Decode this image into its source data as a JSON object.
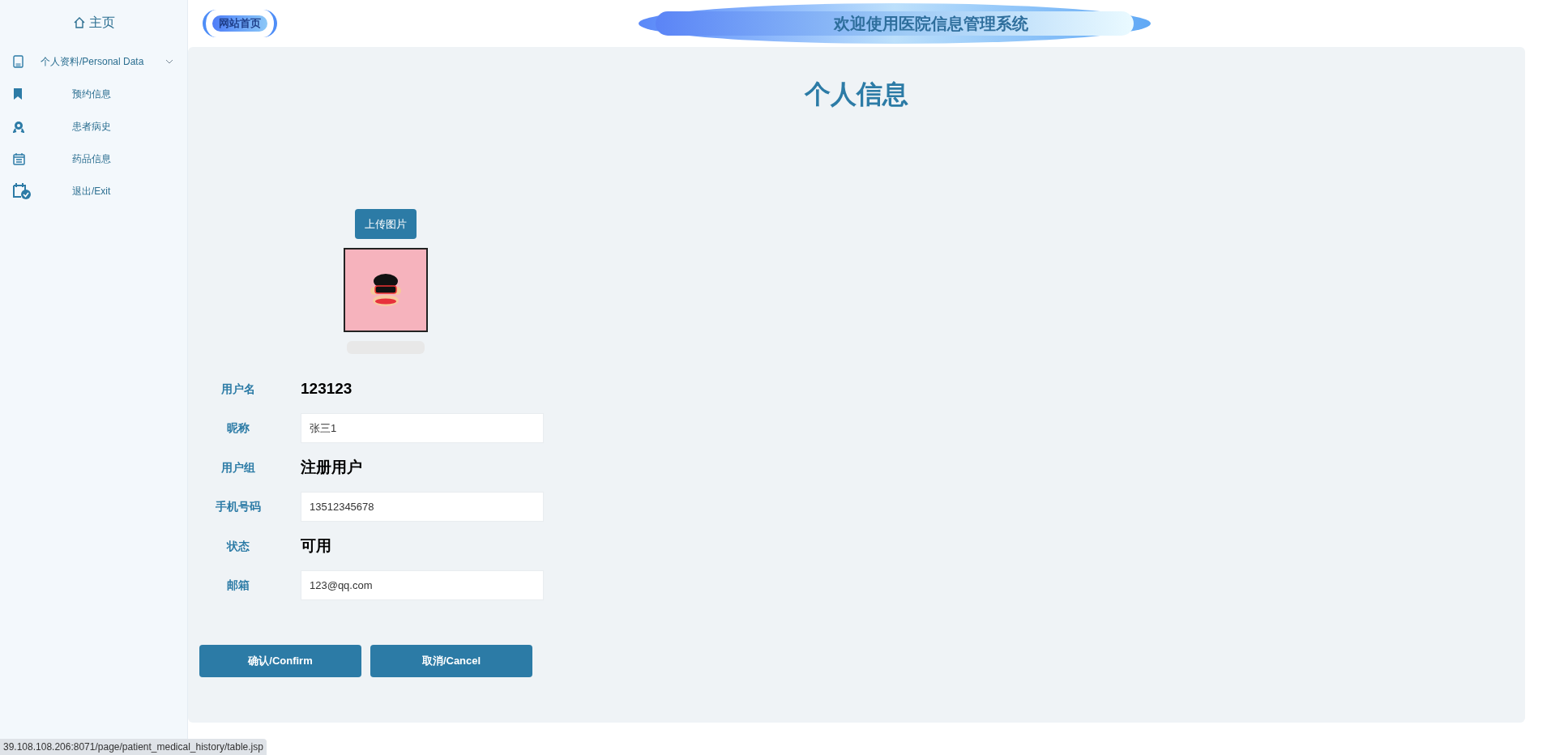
{
  "sidebar": {
    "home": "主页",
    "items": [
      {
        "label": "个人资料/Personal Data",
        "expanded": true,
        "children": [
          {
            "label": "预约信息"
          },
          {
            "label": "患者病史"
          },
          {
            "label": "药品信息"
          },
          {
            "label": "退出/Exit"
          }
        ]
      }
    ]
  },
  "header": {
    "logo": "网站首页",
    "banner": "欢迎使用医院信息管理系统"
  },
  "page": {
    "title": "个人信息",
    "upload_button": "上传图片",
    "fields": [
      {
        "label": "用户名",
        "kind": "text",
        "value": "123123"
      },
      {
        "label": "昵称",
        "kind": "input",
        "value": "张三1"
      },
      {
        "label": "用户组",
        "kind": "text",
        "value": "注册用户"
      },
      {
        "label": "手机号码",
        "kind": "input",
        "value": "13512345678"
      },
      {
        "label": "状态",
        "kind": "text",
        "value": "可用"
      },
      {
        "label": "邮箱",
        "kind": "input",
        "value": "123@qq.com"
      }
    ],
    "buttons": [
      "确认/Confirm",
      "取消/Cancel"
    ]
  },
  "status_bar": "39.108.108.206:8071/page/patient_medical_history/table.jsp"
}
